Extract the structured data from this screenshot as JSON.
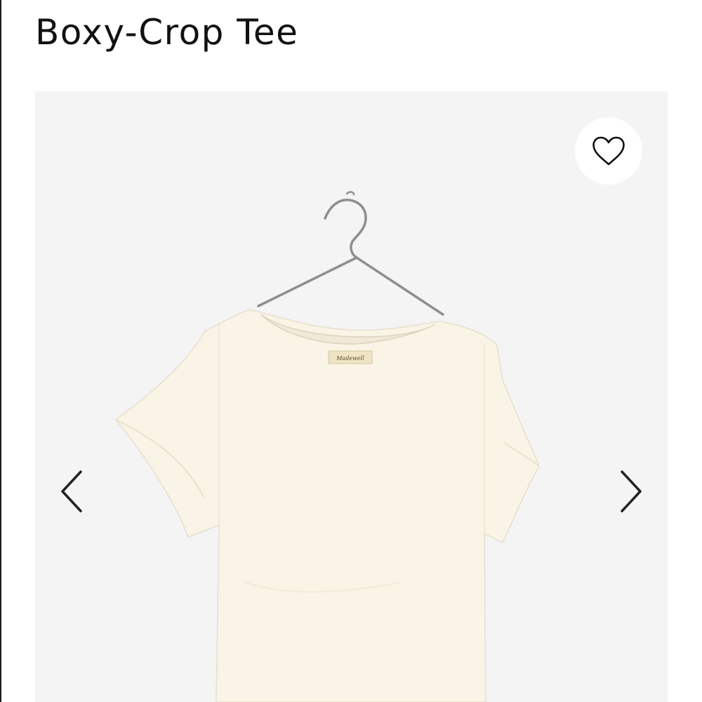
{
  "product": {
    "title": "Boxy-Crop Tee",
    "brand_label": "Madewell"
  },
  "gallery": {
    "background_color": "#f4f4f5",
    "favorite_icon": "heart-outline-icon",
    "prev_icon": "chevron-left-icon",
    "next_icon": "chevron-right-icon"
  },
  "colors": {
    "text": "#111111",
    "tee": "#faf4e6",
    "hanger": "#8e8e8e"
  }
}
